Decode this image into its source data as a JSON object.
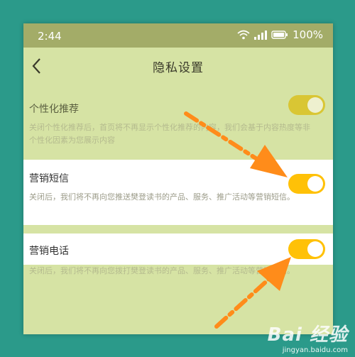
{
  "status_bar": {
    "time": "2:44",
    "battery_text": "100%",
    "icons": [
      "wifi-icon",
      "signal-icon",
      "battery-icon"
    ]
  },
  "nav": {
    "title": "隐私设置",
    "back_icon": "chevron-left-icon"
  },
  "settings": [
    {
      "label": "个性化推荐",
      "description": "关闭个性化推荐后，首页将不再显示个性化推荐的内容，我们会基于内容热度等非个性化因素为您展示内容",
      "enabled": true
    },
    {
      "label": "营销短信",
      "description": "关闭后，我们将不再向您推送樊登读书的产品、服务、推广活动等营销短信。",
      "enabled": true
    },
    {
      "label": "营销电话",
      "description": "关闭后，我们将不再向您拨打樊登读书的产品、服务、推广活动等营销电话。",
      "enabled": true
    }
  ],
  "watermark": {
    "brand": "Bai 经验",
    "url": "jingyan.baidu.com"
  },
  "colors": {
    "background": "#2b9a8a",
    "screen_tint": "#d6e3a4",
    "toggle_on": "#ffc107",
    "arrow": "#ff8c1a"
  }
}
